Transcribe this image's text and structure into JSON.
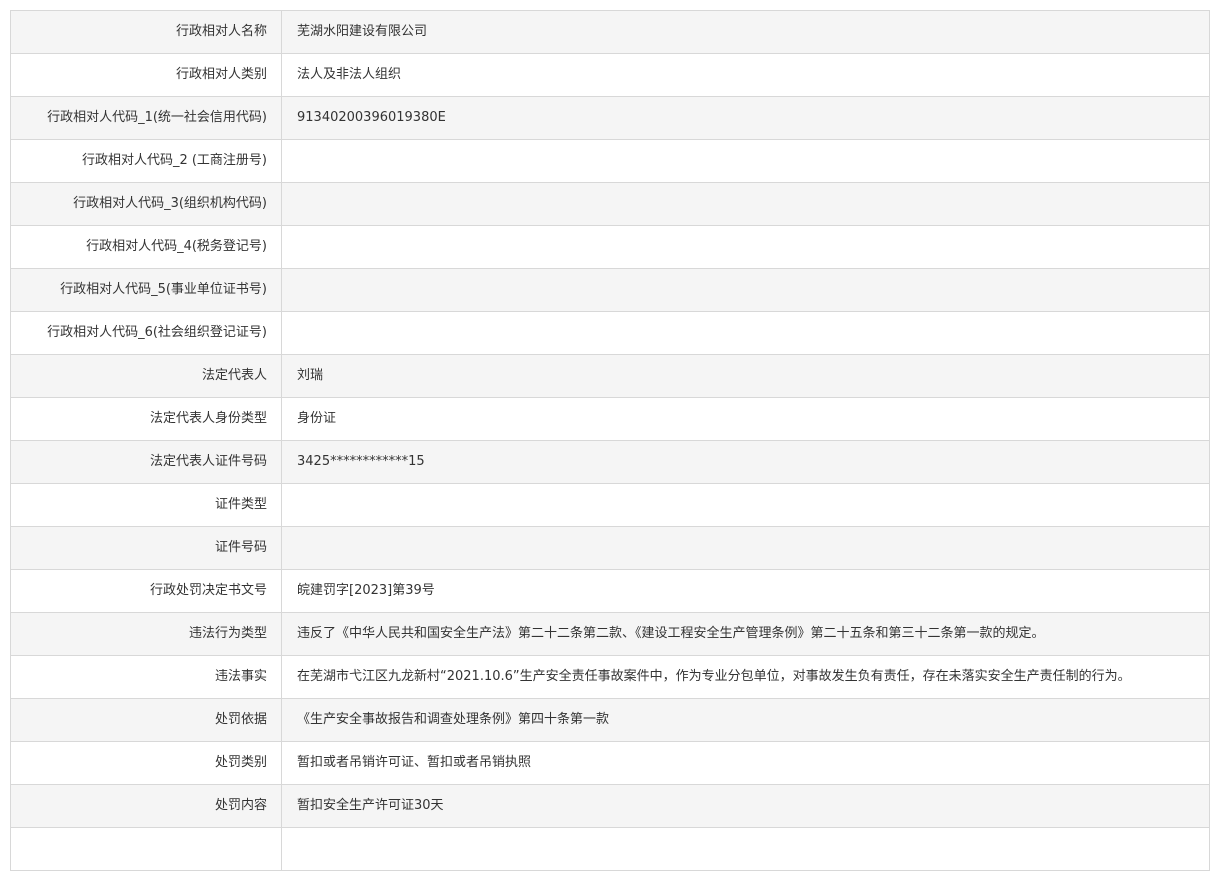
{
  "record": {
    "rows": [
      {
        "label": "行政相对人名称",
        "value": "芜湖水阳建设有限公司"
      },
      {
        "label": "行政相对人类别",
        "value": "法人及非法人组织"
      },
      {
        "label": "行政相对人代码_1(统一社会信用代码)",
        "value": "91340200396019380E"
      },
      {
        "label": "行政相对人代码_2 (工商注册号)",
        "value": ""
      },
      {
        "label": "行政相对人代码_3(组织机构代码)",
        "value": ""
      },
      {
        "label": "行政相对人代码_4(税务登记号)",
        "value": ""
      },
      {
        "label": "行政相对人代码_5(事业单位证书号)",
        "value": ""
      },
      {
        "label": "行政相对人代码_6(社会组织登记证号)",
        "value": ""
      },
      {
        "label": "法定代表人",
        "value": "刘瑞"
      },
      {
        "label": "法定代表人身份类型",
        "value": "身份证"
      },
      {
        "label": "法定代表人证件号码",
        "value": "3425************15"
      },
      {
        "label": "证件类型",
        "value": ""
      },
      {
        "label": "证件号码",
        "value": ""
      },
      {
        "label": "行政处罚决定书文号",
        "value": "皖建罚字[2023]第39号"
      },
      {
        "label": "违法行为类型",
        "value": "违反了《中华人民共和国安全生产法》第二十二条第二款、《建设工程安全生产管理条例》第二十五条和第三十二条第一款的规定。"
      },
      {
        "label": "违法事实",
        "value": "在芜湖市弋江区九龙新村“2021.10.6”生产安全责任事故案件中，作为专业分包单位，对事故发生负有责任，存在未落实安全生产责任制的行为。"
      },
      {
        "label": "处罚依据",
        "value": "《生产安全事故报告和调查处理条例》第四十条第一款"
      },
      {
        "label": "处罚类别",
        "value": "暂扣或者吊销许可证、暂扣或者吊销执照"
      },
      {
        "label": "处罚内容",
        "value": "暂扣安全生产许可证30天"
      },
      {
        "label": "",
        "value": ""
      }
    ]
  }
}
